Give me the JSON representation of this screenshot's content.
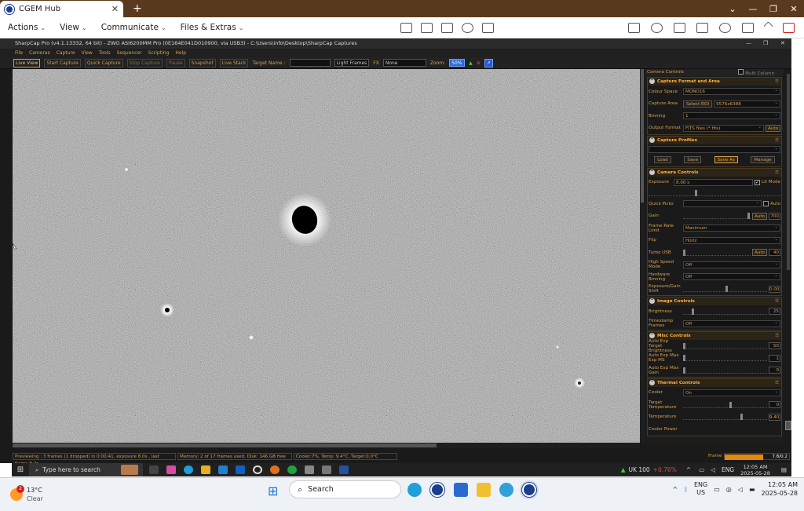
{
  "browser": {
    "tab_title": "CGEM Hub",
    "tab_close": "✕",
    "new_tab": "+",
    "controls": {
      "dropdown": "⌄",
      "minimize": "—",
      "restore": "❐",
      "close": "✕"
    }
  },
  "tv_toolbar": {
    "menus": [
      {
        "label": "Actions"
      },
      {
        "label": "View"
      },
      {
        "label": "Communicate"
      },
      {
        "label": "Files & Extras"
      }
    ],
    "icons": [
      "dashboard-icon",
      "remote-input-icon",
      "file-transfer-icon",
      "session-icon",
      "no-display-icon"
    ],
    "right_icons": [
      "user-icon",
      "chat-icon",
      "call-icon",
      "whiteboard-icon",
      "camera-icon",
      "fullscreen-icon",
      "collapse-icon",
      "end-session-icon"
    ]
  },
  "sharpcap": {
    "title": "SharpCap Pro (v4.1.13332, 64 bit) - ZWO ASI6200MM Pro (0E164E041D010900, via USB3) - C:\\Users\\info\\Desktop\\SharpCap Captures",
    "menu": [
      "File",
      "Cameras",
      "Capture",
      "View",
      "Tools",
      "Sequencer",
      "Scripting",
      "Help"
    ],
    "toolbar": {
      "live_view": "Live View",
      "start_capture": "Start Capture",
      "quick_capture": "Quick Capture",
      "stop_capture": "Stop Capture",
      "pause": "Pause",
      "snapshot": "Snapshot",
      "live_stack": "Live Stack",
      "target_name_label": "Target Name :",
      "target_name_value": "",
      "frame_type": "Light Frames",
      "fx_label": "FX",
      "fx_value": "None",
      "zoom_label": "Zoom:",
      "zoom_value": "50%"
    },
    "panel": {
      "title": "Camera Controls",
      "multi_column": "Multi Column",
      "sections": {
        "capture_format": {
          "title": "Capture Format and Area",
          "colour_space_label": "Colour Space",
          "colour_space": "MONO16",
          "capture_area_label": "Capture Area",
          "select_roi": "Select ROI",
          "capture_area": "9576x6388",
          "binning_label": "Binning",
          "binning": "1",
          "output_format_label": "Output Format",
          "output_format": "FITS files (*.fits)",
          "auto": "Auto"
        },
        "capture_profiles": {
          "title": "Capture Profiles",
          "load": "Load",
          "save": "Save",
          "save_as": "Save As",
          "manage": "Manage"
        },
        "camera_controls": {
          "title": "Camera Controls",
          "exposure_label": "Exposure",
          "exposure": "8.00 s",
          "lx_mode": "LX Mode",
          "quick_picks_label": "Quick Picks",
          "quick_picks_auto": "Auto",
          "gain_label": "Gain",
          "gain_auto": "Auto",
          "gain": "700",
          "frame_rate_label": "Frame Rate Limit",
          "frame_rate": "Maximum",
          "flip_label": "Flip",
          "flip": "Horiz",
          "turbo_label": "Turbo USB",
          "turbo_auto": "Auto",
          "turbo": "40",
          "high_speed_label": "High Speed Mode",
          "high_speed": "Off",
          "hw_binning_label": "Hardware Binning",
          "hw_binning": "Off",
          "exp_gain_shift_label": "Exposure/Gain Shift",
          "exp_gain_shift": "0.00"
        },
        "image_controls": {
          "title": "Image Controls",
          "brightness_label": "Brightness",
          "brightness": "25",
          "timestamp_label": "Timestamp Frames",
          "timestamp": "Off"
        },
        "misc_controls": {
          "title": "Misc Controls",
          "target_bright_label": "Auto Exp Target Brightness",
          "target_bright": "50",
          "max_exp_label": "Auto Exp Max Exp MS",
          "max_exp": "1",
          "max_gain_label": "Auto Exp Max Gain",
          "max_gain": "0"
        },
        "thermal_controls": {
          "title": "Thermal Controls",
          "cooler_label": "Cooler",
          "cooler": "On",
          "target_temp_label": "Target Temperature",
          "target_temp": "0",
          "temperature_label": "Temperature",
          "temperature": "9.40",
          "cooler_power_label": "Cooler Power"
        }
      }
    },
    "status": {
      "preview": "Previewing : 3 frames (1 dropped) in 0:00:41, exposure 8.0s , last frame 9.2s",
      "memory": "Memory: 2 of 17 frames used. Disk: 146 GB free",
      "cooler": "Cooler:7%, Temp: 9.4°C, Target:0.0°C",
      "frame_label": "Frame :",
      "frame_value": "7.8/0.2",
      "frame_progress": 0.6
    }
  },
  "inner_taskbar": {
    "search_placeholder": "Type here to search",
    "stock_name": "UK 100",
    "stock_change": "+0.76%",
    "lang": "ENG",
    "time": "12:05 AM",
    "date": "2025-05-28"
  },
  "outer_taskbar": {
    "temp": "13°C",
    "condition": "Clear",
    "weather_badge": "2",
    "search_placeholder": "Search",
    "lang_top": "ENG",
    "lang_bottom": "US",
    "time": "12:05 AM",
    "date": "2025-05-28"
  },
  "colors": {
    "accent": "#d8a050",
    "section_title": "#ffb040",
    "browser_chrome": "#5a3a1e",
    "progress": "#e08a10"
  }
}
